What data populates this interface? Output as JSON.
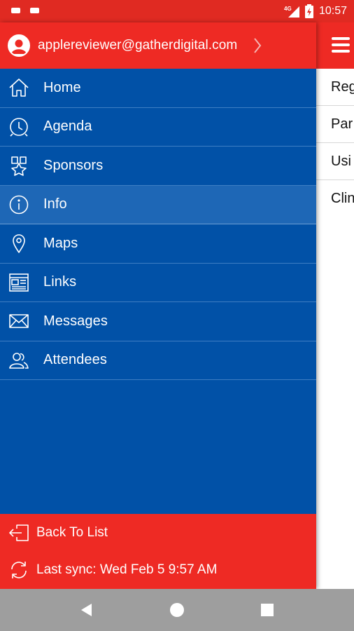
{
  "status_bar": {
    "time": "10:57",
    "network": "4G"
  },
  "drawer": {
    "header": {
      "email": "applereviewer@gatherdigital.com"
    },
    "menu": [
      {
        "label": "Home",
        "icon": "home-icon"
      },
      {
        "label": "Agenda",
        "icon": "clock-icon"
      },
      {
        "label": "Sponsors",
        "icon": "award-ribbon-icon"
      },
      {
        "label": "Info",
        "icon": "info-icon",
        "active": true
      },
      {
        "label": "Maps",
        "icon": "map-pin-icon"
      },
      {
        "label": "Links",
        "icon": "browser-window-icon"
      },
      {
        "label": "Messages",
        "icon": "envelope-icon"
      },
      {
        "label": "Attendees",
        "icon": "people-icon"
      }
    ],
    "footer": {
      "back_label": "Back To List",
      "sync_label": "Last sync: Wed Feb 5 9:57 AM"
    }
  },
  "content": {
    "rows": [
      "Reg",
      "Par",
      "Usi",
      "Clin"
    ]
  },
  "colors": {
    "red": "#ee2a24",
    "blue": "#0151a7",
    "active_blue": "#1e67b6",
    "nav_gray": "#9e9e9e"
  }
}
